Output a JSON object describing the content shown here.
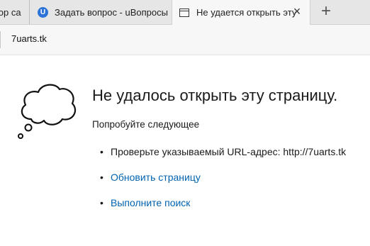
{
  "tabs": [
    {
      "label": "тор са",
      "icon": "partial-tab",
      "active": false
    },
    {
      "label": "Задать вопрос - uВопросы",
      "icon": "uvoprosy-favicon-icon",
      "favicon_letter": "U",
      "active": false
    },
    {
      "label": "Не удается открыть эту",
      "icon": "page-icon",
      "active": true
    }
  ],
  "address": {
    "url": "7uarts.tk"
  },
  "error": {
    "headline": "Не удалось открыть эту страницу.",
    "subhead": "Попробуйте следующее",
    "suggestions": [
      {
        "text": "Проверьте указываемый URL-адрес: http://7uarts.tk",
        "link": false
      },
      {
        "text": "Обновить страницу",
        "link": true
      },
      {
        "text": "Выполните поиск",
        "link": true
      }
    ]
  },
  "colors": {
    "link": "#0063b1",
    "tab_bar": "#e6e6e6",
    "active_tab": "#f7f7f7",
    "favicon": "#2e74d8"
  }
}
